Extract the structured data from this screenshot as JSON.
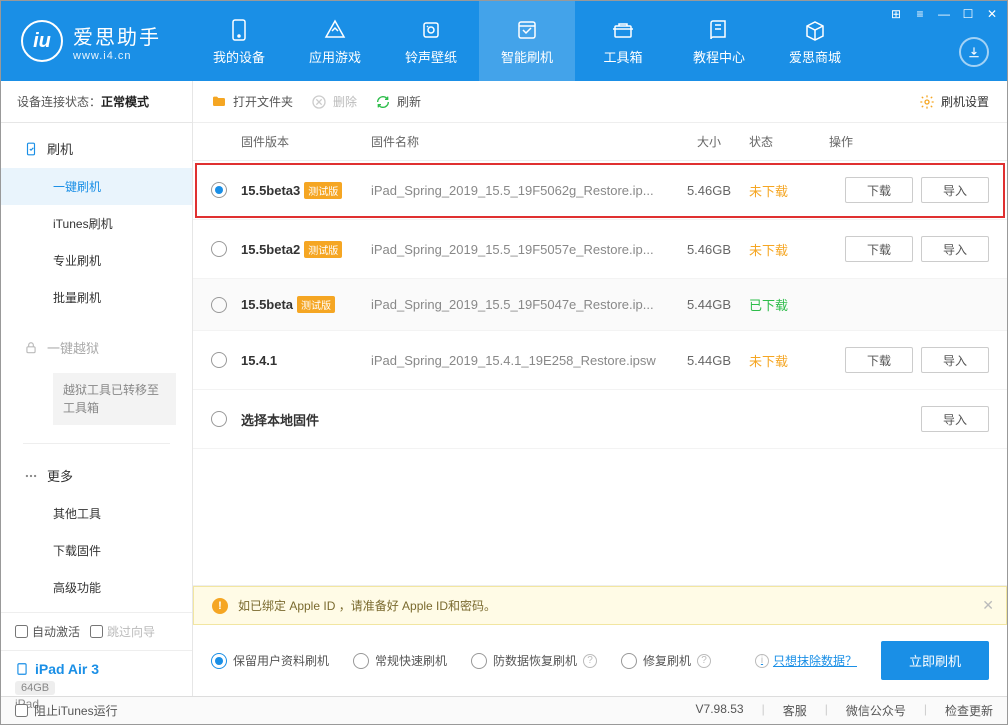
{
  "header": {
    "logo_text": "爱思助手",
    "logo_url": "www.i4.cn",
    "nav": [
      {
        "label": "我的设备"
      },
      {
        "label": "应用游戏"
      },
      {
        "label": "铃声壁纸"
      },
      {
        "label": "智能刷机"
      },
      {
        "label": "工具箱"
      },
      {
        "label": "教程中心"
      },
      {
        "label": "爱思商城"
      }
    ]
  },
  "sidebar": {
    "conn_label": "设备连接状态：",
    "conn_status": "正常模式",
    "sec_flash": "刷机",
    "items_flash": [
      "一键刷机",
      "iTunes刷机",
      "专业刷机",
      "批量刷机"
    ],
    "sec_jail": "一键越狱",
    "jail_note": "越狱工具已转移至工具箱",
    "sec_more": "更多",
    "items_more": [
      "其他工具",
      "下载固件",
      "高级功能"
    ],
    "auto_activate": "自动激活",
    "skip_guide": "跳过向导",
    "device_name": "iPad Air 3",
    "device_storage": "64GB",
    "device_type": "iPad"
  },
  "toolbar": {
    "open_folder": "打开文件夹",
    "delete": "删除",
    "refresh": "刷新",
    "settings": "刷机设置"
  },
  "table": {
    "headers": {
      "ver": "固件版本",
      "name": "固件名称",
      "size": "大小",
      "status": "状态",
      "ops": "操作"
    },
    "btn_download": "下载",
    "btn_import": "导入",
    "beta_tag": "测试版",
    "rows": [
      {
        "ver": "15.5beta3",
        "beta": true,
        "name": "iPad_Spring_2019_15.5_19F5062g_Restore.ip...",
        "size": "5.46GB",
        "status": "未下载",
        "status_cls": "orange",
        "download": true,
        "import": true,
        "selected": true,
        "highlight": true
      },
      {
        "ver": "15.5beta2",
        "beta": true,
        "name": "iPad_Spring_2019_15.5_19F5057e_Restore.ip...",
        "size": "5.46GB",
        "status": "未下载",
        "status_cls": "orange",
        "download": true,
        "import": true
      },
      {
        "ver": "15.5beta",
        "beta": true,
        "name": "iPad_Spring_2019_15.5_19F5047e_Restore.ip...",
        "size": "5.44GB",
        "status": "已下载",
        "status_cls": "green",
        "alt": true
      },
      {
        "ver": "15.4.1",
        "beta": false,
        "name": "iPad_Spring_2019_15.4.1_19E258_Restore.ipsw",
        "size": "5.44GB",
        "status": "未下载",
        "status_cls": "orange",
        "download": true,
        "import": true
      },
      {
        "ver": "选择本地固件",
        "beta": false,
        "name": "",
        "size": "",
        "status": "",
        "status_cls": "",
        "import": true,
        "local": true
      }
    ]
  },
  "notice": {
    "text": "如已绑定 Apple ID ，请准备好 Apple ID和密码。"
  },
  "options": {
    "items": [
      "保留用户资料刷机",
      "常规快速刷机",
      "防数据恢复刷机",
      "修复刷机"
    ],
    "link": "只想抹除数据？",
    "action": "立即刷机"
  },
  "statusbar": {
    "block_itunes": "阻止iTunes运行",
    "version": "V7.98.53",
    "items": [
      "客服",
      "微信公众号",
      "检查更新"
    ]
  }
}
